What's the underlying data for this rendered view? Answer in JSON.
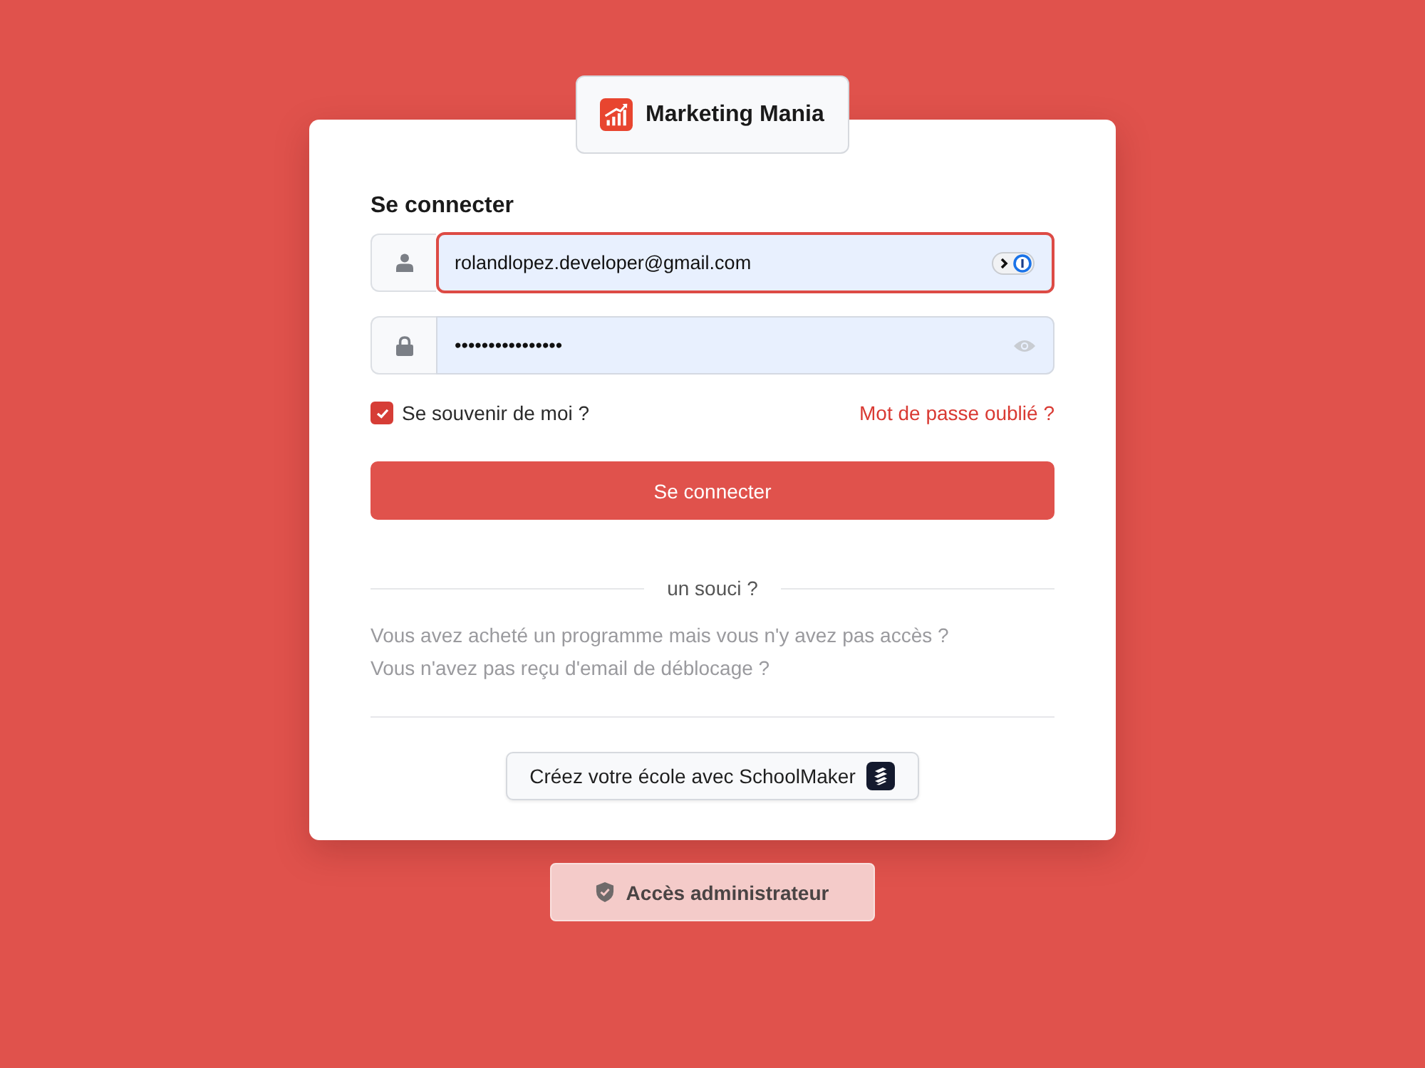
{
  "logo": {
    "name": "Marketing Mania"
  },
  "form": {
    "title": "Se connecter",
    "fields": [
      {
        "kind": "email",
        "value": "rolandlopez.developer@gmail.com",
        "focused": true
      },
      {
        "kind": "password",
        "value": "••••••••••••••••",
        "focused": false
      }
    ],
    "remember": {
      "label": "Se souvenir de moi ?",
      "checked": true
    },
    "forgot_link": "Mot de passe oublié ?",
    "submit": "Se connecter",
    "help": {
      "divider": "un souci ?",
      "links": [
        "Vous avez acheté un programme mais vous n'y avez pas accès ?",
        "Vous n'avez pas reçu d'email de déblocage ?"
      ]
    },
    "schoolmaker_button": "Créez votre école avec SchoolMaker"
  },
  "admin_button": "Accès administrateur"
}
